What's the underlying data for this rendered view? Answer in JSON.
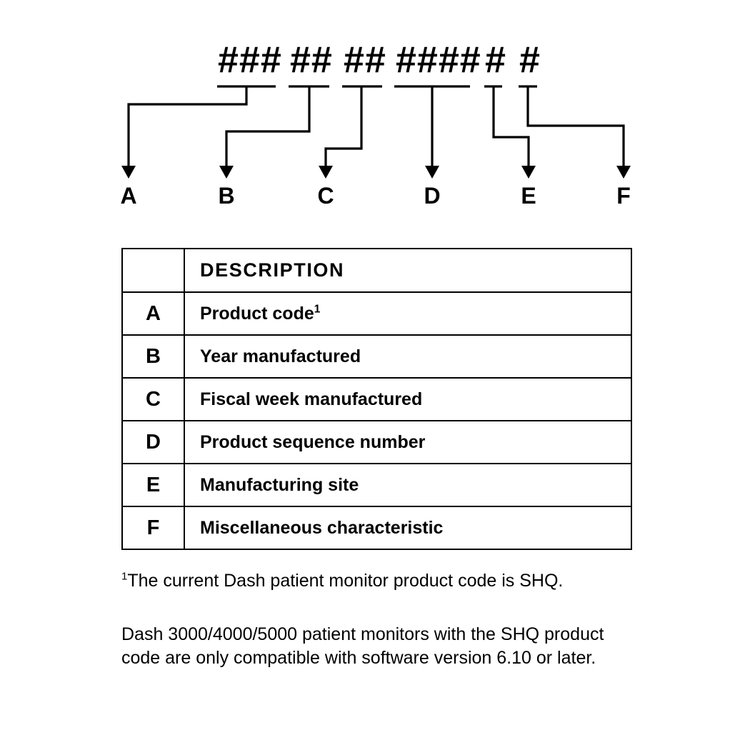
{
  "diagram": {
    "groups": [
      {
        "id": "A",
        "mask": "###",
        "label": "A"
      },
      {
        "id": "B",
        "mask": "##",
        "label": "B"
      },
      {
        "id": "C",
        "mask": "##",
        "label": "C"
      },
      {
        "id": "D",
        "mask": "####",
        "label": "D"
      },
      {
        "id": "E",
        "mask": "#",
        "label": "E"
      },
      {
        "id": "F",
        "mask": "#",
        "label": "F"
      }
    ]
  },
  "table": {
    "header": {
      "key": "",
      "description": "DESCRIPTION"
    },
    "rows": [
      {
        "key": "A",
        "description": "Product code",
        "footnote_marker": "1"
      },
      {
        "key": "B",
        "description": "Year manufactured",
        "footnote_marker": ""
      },
      {
        "key": "C",
        "description": "Fiscal week manufactured",
        "footnote_marker": ""
      },
      {
        "key": "D",
        "description": "Product sequence number",
        "footnote_marker": ""
      },
      {
        "key": "E",
        "description": "Manufacturing site",
        "footnote_marker": ""
      },
      {
        "key": "F",
        "description": "Miscellaneous characteristic",
        "footnote_marker": ""
      }
    ]
  },
  "notes": {
    "footnote_marker": "1",
    "footnote_text": "The current Dash patient monitor product code is SHQ.",
    "compatibility_text": "Dash 3000/4000/5000 patient monitors with the SHQ product code are only compatible with software version 6.10 or later."
  },
  "colors": {
    "ink": "#000000",
    "page": "#ffffff"
  }
}
